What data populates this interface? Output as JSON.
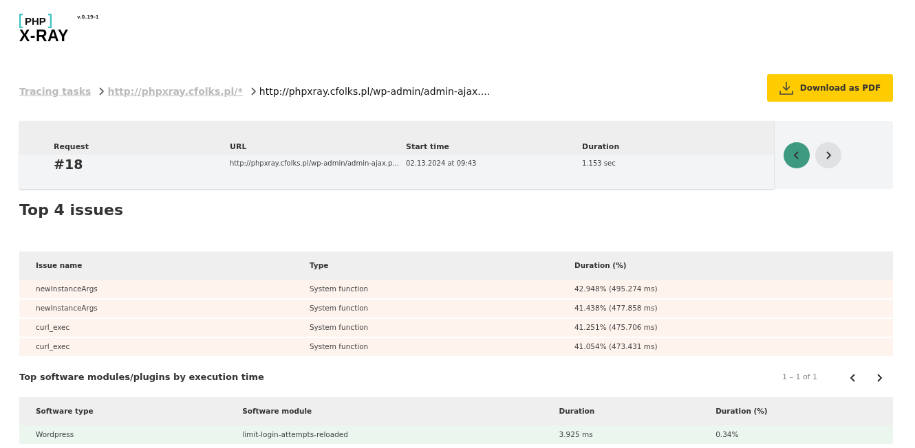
{
  "logo": {
    "top": "PHP",
    "bottom": "X-RAY",
    "version": "v.0.19-1"
  },
  "breadcrumbs": [
    {
      "label": "Tracing tasks",
      "link": true
    },
    {
      "label": "http://phpxray.cfolks.pl/*",
      "link": true
    },
    {
      "label": "http://phpxray.cfolks.pl/wp-admin/admin-ajax....",
      "link": false
    }
  ],
  "download_button": "Download as PDF",
  "request": {
    "fields": [
      {
        "label": "Request",
        "value": "#18",
        "kind": "big"
      },
      {
        "label": "URL",
        "value": "http://phpxray.cfolks.pl/wp-admin/admin-ajax.p...",
        "kind": "small"
      },
      {
        "label": "Start time",
        "value": "02.13.2024 at 09:43",
        "kind": "small"
      },
      {
        "label": "Duration",
        "value": "1.153 sec",
        "kind": "small"
      }
    ],
    "nav": [
      {
        "kind": "prev",
        "highlighted": true
      },
      {
        "kind": "next",
        "highlighted": false
      }
    ]
  },
  "issues": {
    "title": "Top 4 issues",
    "columns": [
      "Issue name",
      "Type",
      "Duration (%)"
    ],
    "rows": [
      [
        "newInstanceArgs",
        "System function",
        "42.948% (495.274 ms)"
      ],
      [
        "newInstanceArgs",
        "System function",
        "41.438% (477.858 ms)"
      ],
      [
        "curl_exec",
        "System function",
        "41.251% (475.706 ms)"
      ],
      [
        "curl_exec",
        "System function",
        "41.054% (473.431 ms)"
      ]
    ]
  },
  "modules": {
    "title": "Top software modules/plugins by execution time",
    "pagination": "1 – 1 of 1",
    "columns": [
      "Software type",
      "Software module",
      "Duration",
      "Duration (%)"
    ],
    "rows": [
      [
        "Wordpress",
        "limit-login-attempts-reloaded",
        "3.925 ms",
        "0.34%"
      ]
    ]
  }
}
